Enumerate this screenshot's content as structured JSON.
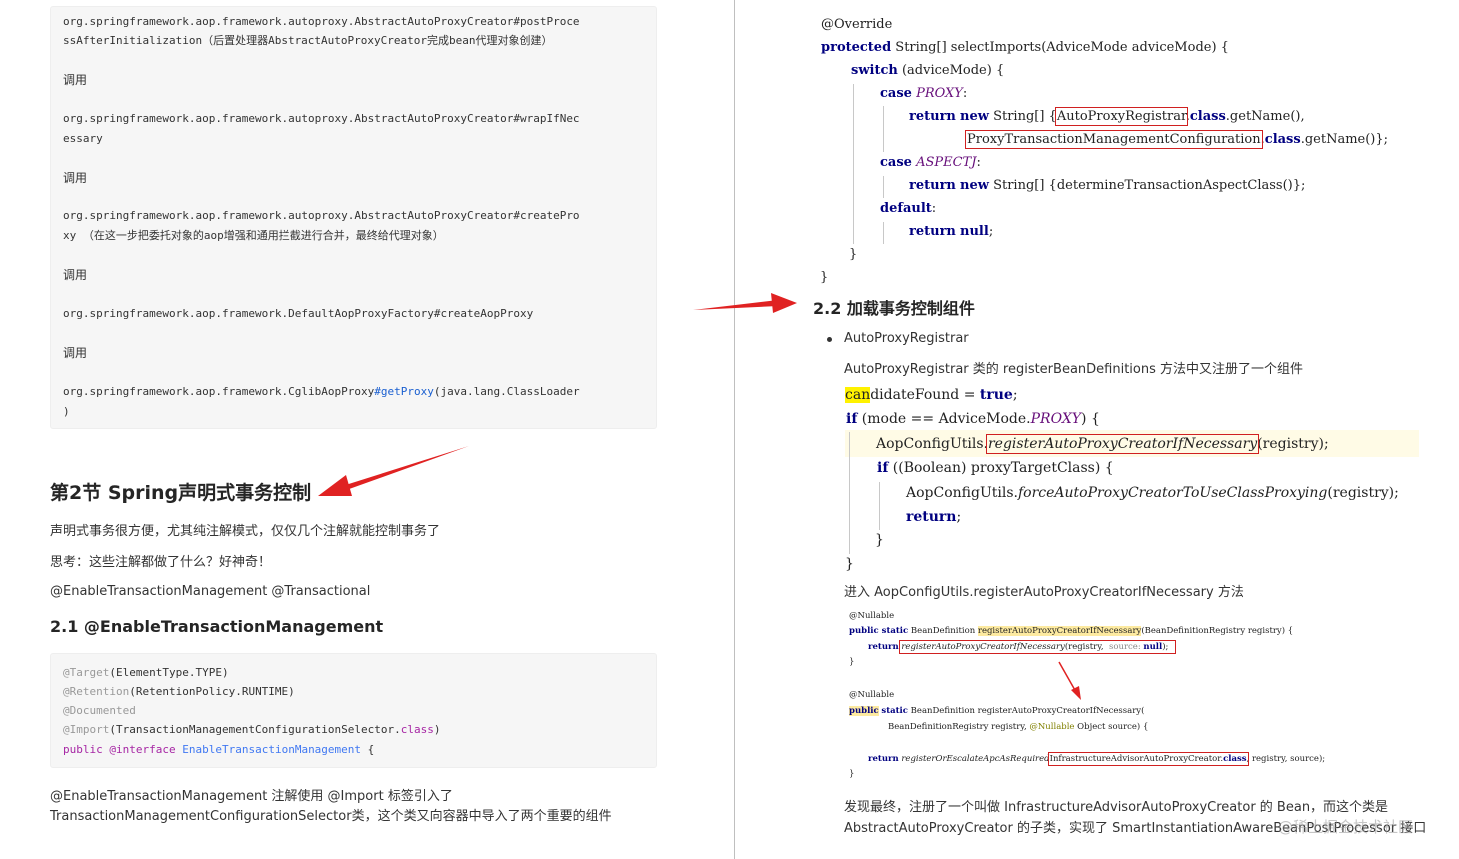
{
  "left": {
    "code_block_1": {
      "lines": [
        "org.springframework.aop.framework.autoproxy.AbstractAutoProxyCreator#postProce",
        "ssAfterInitialization（后置处理器AbstractAutoProxyCreator完成bean代理对象创建）",
        "调用",
        "org.springframework.aop.framework.autoproxy.AbstractAutoProxyCreator#wrapIfNec",
        "essary",
        "调用",
        "org.springframework.aop.framework.autoproxy.AbstractAutoProxyCreator#createPro",
        "xy （在这一步把委托对象的aop增强和通用拦截进行合并，最终给代理对象）",
        "调用",
        "org.springframework.aop.framework.DefaultAopProxyFactory#createAopProxy",
        "调用",
        "org.springframework.aop.framework.CglibAopProxy",
        "#getProxy",
        "(java.lang.ClassLoader",
        ")"
      ]
    },
    "section_title": "第2节 Spring声明式事务控制",
    "para1": "声明式事务很方便，尤其纯注解模式，仅仅几个注解就能控制事务了",
    "para2": "思考：这些注解都做了什么？好神奇！",
    "para3": "@EnableTransactionManagement @Transactional",
    "subsection_title": "2.1 @EnableTransactionManagement",
    "code_block_2": {
      "l1a": "@Target",
      "l1b": "(ElementType.TYPE)",
      "l2a": "@Retention",
      "l2b": "(RetentionPolicy.RUNTIME)",
      "l3": "@Documented",
      "l4a": "@Import",
      "l4b": "(TransactionManagementConfigurationSelector.",
      "l4c": "class",
      "l4d": ")",
      "l5a": "public",
      "l5b": "@interface",
      "l5c": "EnableTransactionManagement",
      "l5d": "{"
    },
    "para4_line1": "@EnableTransactionManagement 注解使用 @Import 标签引入了",
    "para4_line2": "TransactionManagementConfigurationSelector类，这个类又向容器中导入了两个重要的组件"
  },
  "right": {
    "code_top": {
      "override": "@Override",
      "sig_kw": "protected",
      "sig_rest": " String[] selectImports(AdviceMode adviceMode) {",
      "switch_kw": "switch",
      "switch_rest": " (adviceMode) {",
      "case_kw": "case",
      "proxy": "PROXY",
      "colon": ":",
      "return_kw": "return",
      "new_kw": "new",
      "string_arr": " String[] {",
      "auto_proxy_registrar": "AutoProxyRegistrar",
      "class_kw": "class",
      "get_name": ".getName(),",
      "ptmc": "ProxyTransactionManagementConfiguration",
      "get_name_end": ".getName()};",
      "aspectj": "ASPECTJ",
      "determine": " String[] {determineTransactionAspectClass()};",
      "default_kw": "default",
      "null_kw": "null",
      "semicolon": ";",
      "close_brace": "}"
    },
    "section_title": "2.2 加载事务控制组件",
    "bullet": "AutoProxyRegistrar",
    "desc1": "AutoProxyRegistrar 类的 registerBeanDefinitions 方法中又注册了一个组件",
    "code_mid": {
      "can_hl": "can",
      "didate_found": "didateFound",
      "eq": " = ",
      "true_kw": "true",
      "if_kw": "if",
      "mode_cond": " (mode == AdviceMode.",
      "proxy": "PROXY",
      "close_open": ") {",
      "aop_utils": "AopConfigUtils.",
      "register_if_needed": "registerAutoProxyCreatorIfNecessary",
      "registry_end": "(registry);",
      "boolean_cond": " ((Boolean) proxyTargetClass) {",
      "force_method": "forceAutoProxyCreatorToUseClassProxying",
      "return_kw": "return",
      "semicolon": ";",
      "close_brace": "}"
    },
    "desc2": "进入 AopConfigUtils.registerAutoProxyCreatorIfNecessary 方法",
    "code_small": {
      "nullable": "@Nullable",
      "public_static": "public static",
      "bean_def": " BeanDefinition ",
      "reg_method": "registerAutoProxyCreatorIfNecessary",
      "params1": "(BeanDefinitionRegistry registry) {",
      "return_kw": "return",
      "call1": "registerAutoProxyCreatorIfNecessary",
      "call1_args": "(registry, ",
      "source_hint": "source:",
      "null_kw": "null",
      "call1_end": ");",
      "close_brace": "}",
      "nullable2": "@Nullable",
      "public_kw": "public",
      "static_kw": "static",
      "sig2": " BeanDefinition registerAutoProxyCreatorIfNecessary(",
      "params2a": "BeanDefinitionRegistry registry, ",
      "params2_nullable": "@Nullable",
      "params2b": " Object source) {",
      "escalate": "registerOrEscalateApcAsRequired",
      "paren_open": "(",
      "infra": "InfrastructureAdvisorAutoProxyCreator.",
      "class_kw": "class",
      "params3": ", registry, source);"
    },
    "desc3_line1": "发现最终，注册了一个叫做 InfrastructureAdvisorAutoProxyCreator 的 Bean，而这个类是",
    "desc3_line2": "AbstractAutoProxyCreator 的子类，实现了 SmartInstantiationAwareBeanPostProcessor 接口",
    "watermark": "@稀土掘金技术社区"
  },
  "colors": {
    "arrow_red": "#e02222",
    "box_red": "#d02020",
    "keyword": "#000080",
    "annotation": "#808000",
    "italic_const": "#660e7a",
    "highlight_yellow": "#fff200"
  }
}
